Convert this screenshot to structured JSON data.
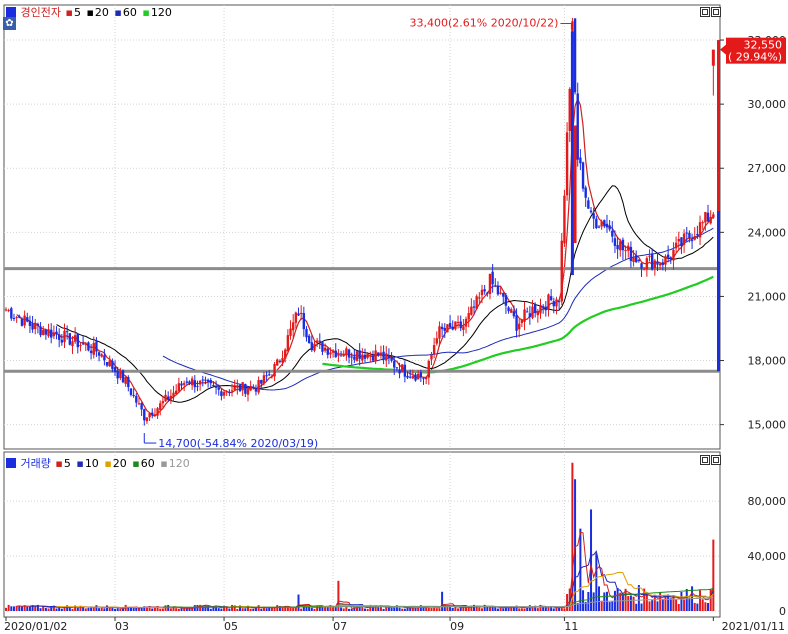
{
  "header": {
    "stock_name": "경인전자",
    "ma_labels": [
      "5",
      "20",
      "60",
      "120"
    ],
    "ma_colors": [
      "#d02020",
      "#000000",
      "#1e2ab8",
      "#22cc22"
    ],
    "candle_icon": "candlestick-icon",
    "settings_icon": "gear-icon"
  },
  "volume_header": {
    "name": "거래량",
    "ma_labels": [
      "5",
      "10",
      "20",
      "60",
      "120"
    ],
    "ma_colors": [
      "#d02020",
      "#1e2ab8",
      "#e0a000",
      "#1a8a1a",
      "#999999"
    ]
  },
  "price_axis_labels": [
    "33,000",
    "30,000",
    "27,000",
    "24,000",
    "21,000",
    "18,000",
    "15,000"
  ],
  "volume_axis_labels": [
    "80,000",
    "40,000",
    "0"
  ],
  "x_axis_labels": [
    "2020/01/02",
    "03",
    "05",
    "07",
    "09",
    "11",
    "2021/01/11"
  ],
  "annotations": {
    "high": "33,400(2.61% 2020/10/22)",
    "low": "14,700(-54.84% 2020/03/19)"
  },
  "current_price": {
    "price": "32,550",
    "change": "( 29.94%)"
  },
  "colors": {
    "up": "#e41a1a",
    "down": "#1a2ee0",
    "support_line": "#8c8c8c",
    "grid": "#d4d4d4"
  },
  "chart_data": [
    {
      "type": "candlestick",
      "x": [
        "2020/01/02",
        "2021/01/11"
      ],
      "ylim": [
        14000,
        34500
      ],
      "yticks": [
        15000,
        18000,
        21000,
        24000,
        27000,
        30000,
        33000
      ],
      "series": [
        {
          "name": "5",
          "color": "#d02020"
        },
        {
          "name": "20",
          "color": "#000000"
        },
        {
          "name": "60",
          "color": "#1e2ab8"
        },
        {
          "name": "120",
          "color": "#22cc22"
        }
      ],
      "support_lines": [
        22300,
        17500
      ],
      "high": {
        "value": 33400,
        "date": "2020/10/22"
      },
      "low": {
        "value": 14700,
        "date": "2020/03/19"
      },
      "last_close": 32550,
      "last_change_pct": 29.94,
      "keypoints": [
        [
          0,
          20400
        ],
        [
          10,
          19600
        ],
        [
          22,
          19100
        ],
        [
          35,
          18400
        ],
        [
          45,
          17000
        ],
        [
          52,
          15400
        ],
        [
          58,
          15900
        ],
        [
          68,
          17100
        ],
        [
          80,
          16600
        ],
        [
          95,
          16800
        ],
        [
          102,
          17800
        ],
        [
          110,
          20300
        ],
        [
          115,
          18800
        ],
        [
          125,
          18400
        ],
        [
          140,
          18300
        ],
        [
          150,
          17500
        ],
        [
          158,
          17200
        ],
        [
          162,
          19300
        ],
        [
          172,
          19600
        ],
        [
          182,
          21700
        ],
        [
          186,
          21000
        ],
        [
          192,
          19700
        ],
        [
          198,
          20400
        ],
        [
          208,
          21000
        ],
        [
          213,
          33400
        ],
        [
          215,
          27500
        ],
        [
          220,
          24600
        ],
        [
          225,
          24500
        ],
        [
          232,
          23200
        ],
        [
          240,
          22600
        ],
        [
          248,
          22700
        ],
        [
          256,
          23700
        ],
        [
          262,
          24400
        ],
        [
          266,
          25000
        ]
      ]
    },
    {
      "type": "bar",
      "name": "거래량",
      "ylim": [
        0,
        110000
      ],
      "yticks": [
        0,
        40000,
        80000
      ],
      "spikes": [
        [
          213,
          108000
        ],
        [
          214,
          96000
        ],
        [
          216,
          60000
        ],
        [
          220,
          74000
        ],
        [
          222,
          42000
        ],
        [
          266,
          52000
        ],
        [
          125,
          22000
        ],
        [
          110,
          12000
        ],
        [
          164,
          14000
        ]
      ]
    }
  ]
}
